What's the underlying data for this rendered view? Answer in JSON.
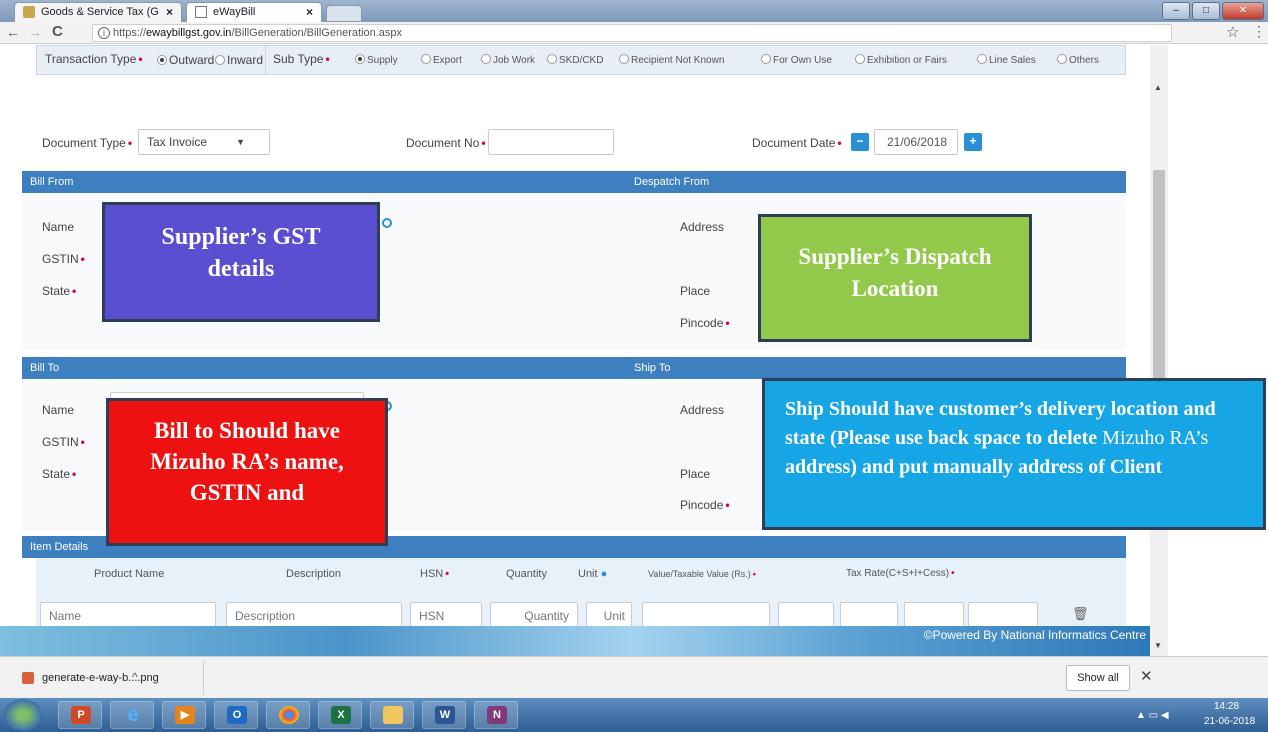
{
  "browser": {
    "tabs": [
      {
        "title": "Goods & Service Tax (G"
      },
      {
        "title": "eWayBill"
      }
    ],
    "url_prefix": "https://",
    "url_host": "ewaybillgst.gov.in",
    "url_path": "/BillGeneration/BillGeneration.aspx"
  },
  "transaction": {
    "type_label": "Transaction Type",
    "outward": "Outward",
    "inward": "Inward",
    "subtype_label": "Sub Type",
    "subtypes": [
      "Supply",
      "Export",
      "Job Work",
      "SKD/CKD",
      "Recipient Not Known",
      "For Own Use",
      "Exhibition or Fairs",
      "Line Sales",
      "Others"
    ]
  },
  "document": {
    "type_label": "Document Type",
    "type_value": "Tax Invoice",
    "no_label": "Document No",
    "date_label": "Document Date",
    "date_value": "21/06/2018"
  },
  "sections": {
    "bill_from": "Bill From",
    "despatch_from": "Despatch From",
    "bill_to": "Bill To",
    "ship_to": "Ship To",
    "item_details": "Item Details"
  },
  "fields": {
    "name": "Name",
    "gstin": "GSTIN",
    "state": "State",
    "address": "Address",
    "place": "Place",
    "pincode": "Pincode"
  },
  "callouts": {
    "supplier_gst": "Supplier’s GST details",
    "dispatch": "Supplier’s Dispatch Location",
    "bill_to": "Bill to Should have Mizuho RA’s name, GSTIN and",
    "ship_bold1": "Ship Should have customer’s delivery location and state (Please use back space to delete ",
    "ship_plain": "Mizuho RA’s",
    "ship_bold2": " address) and put manually address of Client"
  },
  "items": {
    "headers": [
      "Product Name",
      "Description",
      "HSN",
      "Quantity",
      "Unit",
      "Value/Taxable Value (Rs.)",
      "Tax Rate(C+S+I+Cess)"
    ],
    "placeholders": [
      "Name",
      "Description",
      "HSN",
      "Quantity",
      "Unit"
    ]
  },
  "footer": {
    "powered": "©Powered By National Informatics Centre"
  },
  "download": {
    "file": "generate-e-way-b....png",
    "show_all": "Show all"
  },
  "clock": {
    "time": "14:28",
    "date": "21-06-2018"
  },
  "colors": {
    "section_blue": "#3d7fbf",
    "callout_purple": "#5a4fd0",
    "callout_green": "#92c94a",
    "callout_red": "#ee1111",
    "callout_cyan": "#16a6e6"
  }
}
